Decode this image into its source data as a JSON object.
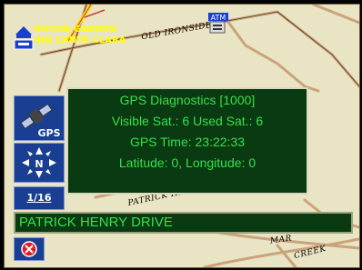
{
  "map": {
    "poi_label_line1": "HILTON GARDEN",
    "poi_label_line2": "INN SANTA CLARA",
    "atm_label": "ATM",
    "road_labels": {
      "top": "OLD IRONSIDES",
      "mid": "PATRICK HENR",
      "bottom_right_1": "MAR",
      "bottom_right_2": "CREEK"
    }
  },
  "sidebar": {
    "gps_label": "GPS",
    "compass_label": "N",
    "zoom_label": "1/16"
  },
  "diagnostics": {
    "title": "GPS Diagnostics [1000]",
    "satellites": "Visible Sat.: 6 Used Sat.: 6",
    "time": "GPS Time: 23:22:33",
    "position": "Latitude: 0, Longitude: 0"
  },
  "street": {
    "name": "PATRICK HENRY DRIVE"
  },
  "colors": {
    "map_bg": "#e9e4c3",
    "road": "#c9a37c",
    "panel_bg": "#0a3a12",
    "panel_text": "#36e04a",
    "button_bg": "#1a3f92"
  }
}
